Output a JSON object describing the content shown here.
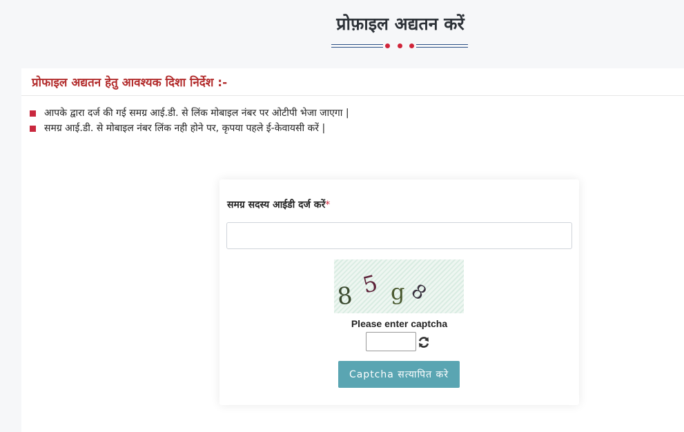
{
  "page": {
    "title": "प्रोफ़ाइल अद्यतन करें"
  },
  "guidelines": {
    "title": "प्रोफाइल अद्यतन हेतु आवश्यक दिशा निर्देश :-",
    "items": [
      "आपके द्वारा दर्ज की गई समग्र आई.डी. से लिंक मोबाइल नंबर पर ओटीपी भेजा जाएगा |",
      "समग्र आई.डी. से मोबाइल नंबर लिंक नही होने पर, कृपया पहले ई-केवायसी करें |"
    ]
  },
  "form": {
    "id_label": "समग्र सदस्य आईडी दर्ज करें",
    "required_mark": "*",
    "id_value": "",
    "captcha_chars": [
      "8",
      "5",
      "g",
      "8"
    ],
    "captcha_prompt": "Please enter captcha",
    "captcha_value": "",
    "refresh_icon": "refresh-icon",
    "verify_label": "Captcha सत्यापित करे"
  },
  "colors": {
    "heading_red": "#b22b2b",
    "bullet_red": "#c9283e",
    "button_teal": "#5aa5b2",
    "ornament_blue": "#2b4f86"
  }
}
